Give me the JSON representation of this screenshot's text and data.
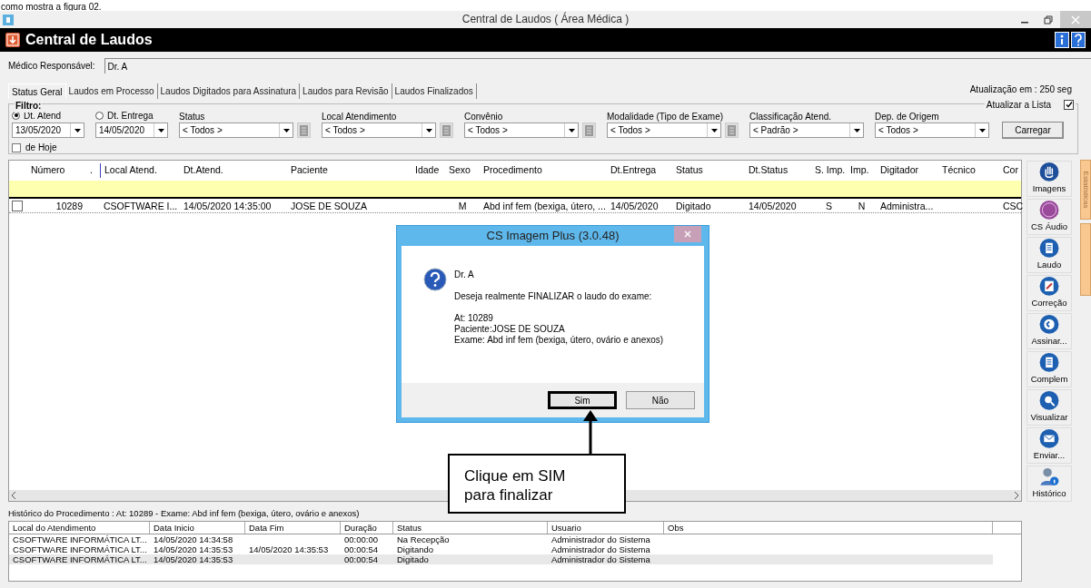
{
  "doc_caption": "como mostra a figura 02.",
  "window": {
    "title": "Central de Laudos ( Área Médica )"
  },
  "header": {
    "title": "Central de Laudos"
  },
  "medico": {
    "label": "Médico Responsável:",
    "value": "Dr. A"
  },
  "tabs": [
    {
      "label": "Status Geral",
      "selected": true
    },
    {
      "label": "Laudos em Processo",
      "selected": false
    },
    {
      "label": "Laudos Digitados para Assinatura",
      "selected": false
    },
    {
      "label": "Laudos para Revisão",
      "selected": false
    },
    {
      "label": "Laudos Finalizados",
      "selected": false
    }
  ],
  "refresh_info": "Atualização em : 250 seg",
  "filter": {
    "title": "Filtro:",
    "auto_refresh": {
      "label": "Atualizar a Lista",
      "checked": true
    },
    "date_modes": [
      {
        "label": "Dt. Atend",
        "selected": true
      },
      {
        "label": "Dt. Entrega",
        "selected": false
      }
    ],
    "date_from": "13/05/2020",
    "date_to": "14/05/2020",
    "today": {
      "label": "de Hoje",
      "checked": false
    },
    "dropdowns": [
      {
        "label": "Status",
        "value": "< Todos >",
        "list_button": true
      },
      {
        "label": "Local Atendimento",
        "value": "<  Todos  >",
        "list_button": true
      },
      {
        "label": "Convênio",
        "value": "<  Todos  >",
        "list_button": true
      },
      {
        "label": "Modalidade (Tipo de Exame)",
        "value": "<  Todos  >",
        "list_button": true
      },
      {
        "label": "Classificação Atend.",
        "value": "< Padrão >",
        "list_button": false
      },
      {
        "label": "Dep. de Origem",
        "value": "<  Todos  >",
        "list_button": false
      }
    ],
    "load_button": "Carregar"
  },
  "grid": {
    "columns": [
      "Número",
      ".",
      "Local Atend.",
      "Dt.Atend.",
      "Paciente",
      "Idade",
      "Sexo",
      "Procedimento",
      "Dt.Entrega",
      "Status",
      "Dt.Status",
      "S. Imp.",
      "Imp.",
      "Digitador",
      "Técnico",
      "Cor"
    ],
    "rows": [
      {
        "checked": false,
        "cells": [
          "10289",
          "",
          "CSOFTWARE I...",
          "14/05/2020 14:35:00",
          "JOSE DE SOUZA",
          "",
          "M",
          "Abd inf fem (bexiga, útero, ...",
          "14/05/2020",
          "Digitado",
          "14/05/2020",
          "S",
          "N",
          "Administra...",
          "",
          "CSC"
        ]
      }
    ]
  },
  "toolbar": [
    {
      "label": "Imagens",
      "kind": "hand"
    },
    {
      "label": "CS Áudio",
      "kind": "cs"
    },
    {
      "label": "Laudo",
      "kind": "doc"
    },
    {
      "label": "Correção",
      "kind": "edit"
    },
    {
      "label": "Assinar...",
      "kind": "sign"
    },
    {
      "label": "Complem",
      "kind": "doc"
    },
    {
      "label": "Visualizar",
      "kind": "view"
    },
    {
      "label": "Enviar...",
      "kind": "mail"
    },
    {
      "label": "Histórico",
      "kind": "person"
    }
  ],
  "side_tabs": [
    {
      "label": "Estatísticas"
    }
  ],
  "history": {
    "title": "Histórico do Procedimento : At: 10289 - Exame: Abd inf fem (bexiga, útero, ovário e anexos)",
    "columns": [
      "Local do Atendimento",
      "Data Inicio",
      "Data Fim",
      "Duração",
      "Status",
      "Usuario",
      "Obs"
    ],
    "rows": [
      {
        "selected": false,
        "cells": [
          "CSOFTWARE INFORMÁTICA LT...",
          "14/05/2020 14:34:58",
          "",
          "00:00:00",
          "Na Recepção",
          "Administrador do Sistema",
          ""
        ]
      },
      {
        "selected": false,
        "cells": [
          "CSOFTWARE INFORMÁTICA LT...",
          "14/05/2020 14:35:53",
          "14/05/2020 14:35:53",
          "00:00:54",
          "Digitando",
          "Administrador do Sistema",
          ""
        ]
      },
      {
        "selected": true,
        "cells": [
          "CSOFTWARE INFORMÁTICA LT...",
          "14/05/2020 14:35:53",
          "",
          "00:00:54",
          "Digitado",
          "Administrador do Sistema",
          ""
        ]
      }
    ]
  },
  "dialog": {
    "title": "CS Imagem Plus (3.0.48)",
    "heading": "Dr. A",
    "message": "Deseja realmente FINALIZAR o laudo do exame:",
    "details": [
      "At: 10289",
      "Paciente:JOSE DE SOUZA",
      "Exame: Abd inf fem (bexiga, útero, ovário e anexos)"
    ],
    "buttons": [
      {
        "label": "Sim",
        "highlighted": true
      },
      {
        "label": "Não",
        "highlighted": false
      }
    ]
  },
  "callout": {
    "lines": [
      "Clique em SIM",
      "para finalizar"
    ]
  }
}
